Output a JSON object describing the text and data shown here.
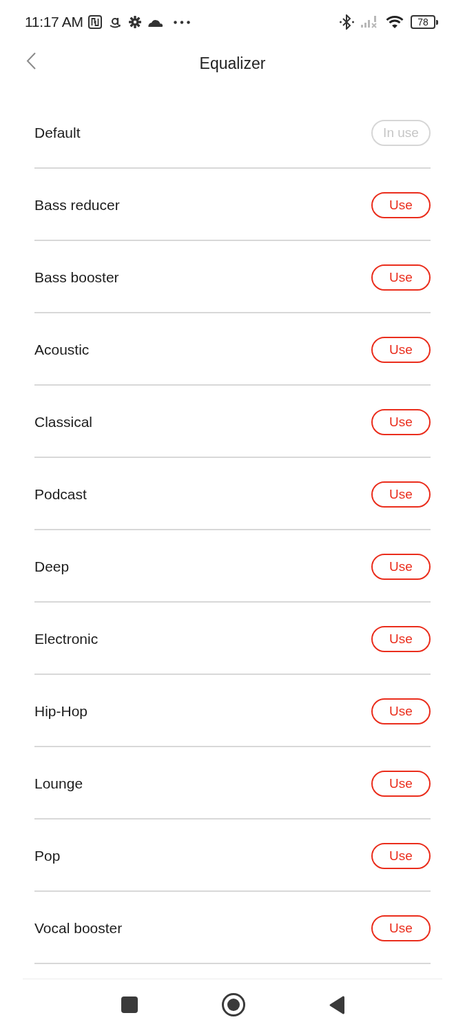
{
  "status_bar": {
    "time": "11:17 AM",
    "battery": "78"
  },
  "header": {
    "title": "Equalizer"
  },
  "presets": [
    {
      "name": "Default",
      "action": "In use",
      "in_use": true
    },
    {
      "name": "Bass reducer",
      "action": "Use",
      "in_use": false
    },
    {
      "name": "Bass booster",
      "action": "Use",
      "in_use": false
    },
    {
      "name": "Acoustic",
      "action": "Use",
      "in_use": false
    },
    {
      "name": "Classical",
      "action": "Use",
      "in_use": false
    },
    {
      "name": "Podcast",
      "action": "Use",
      "in_use": false
    },
    {
      "name": "Deep",
      "action": "Use",
      "in_use": false
    },
    {
      "name": "Electronic",
      "action": "Use",
      "in_use": false
    },
    {
      "name": "Hip-Hop",
      "action": "Use",
      "in_use": false
    },
    {
      "name": "Lounge",
      "action": "Use",
      "in_use": false
    },
    {
      "name": "Pop",
      "action": "Use",
      "in_use": false
    },
    {
      "name": "Vocal booster",
      "action": "Use",
      "in_use": false
    }
  ]
}
